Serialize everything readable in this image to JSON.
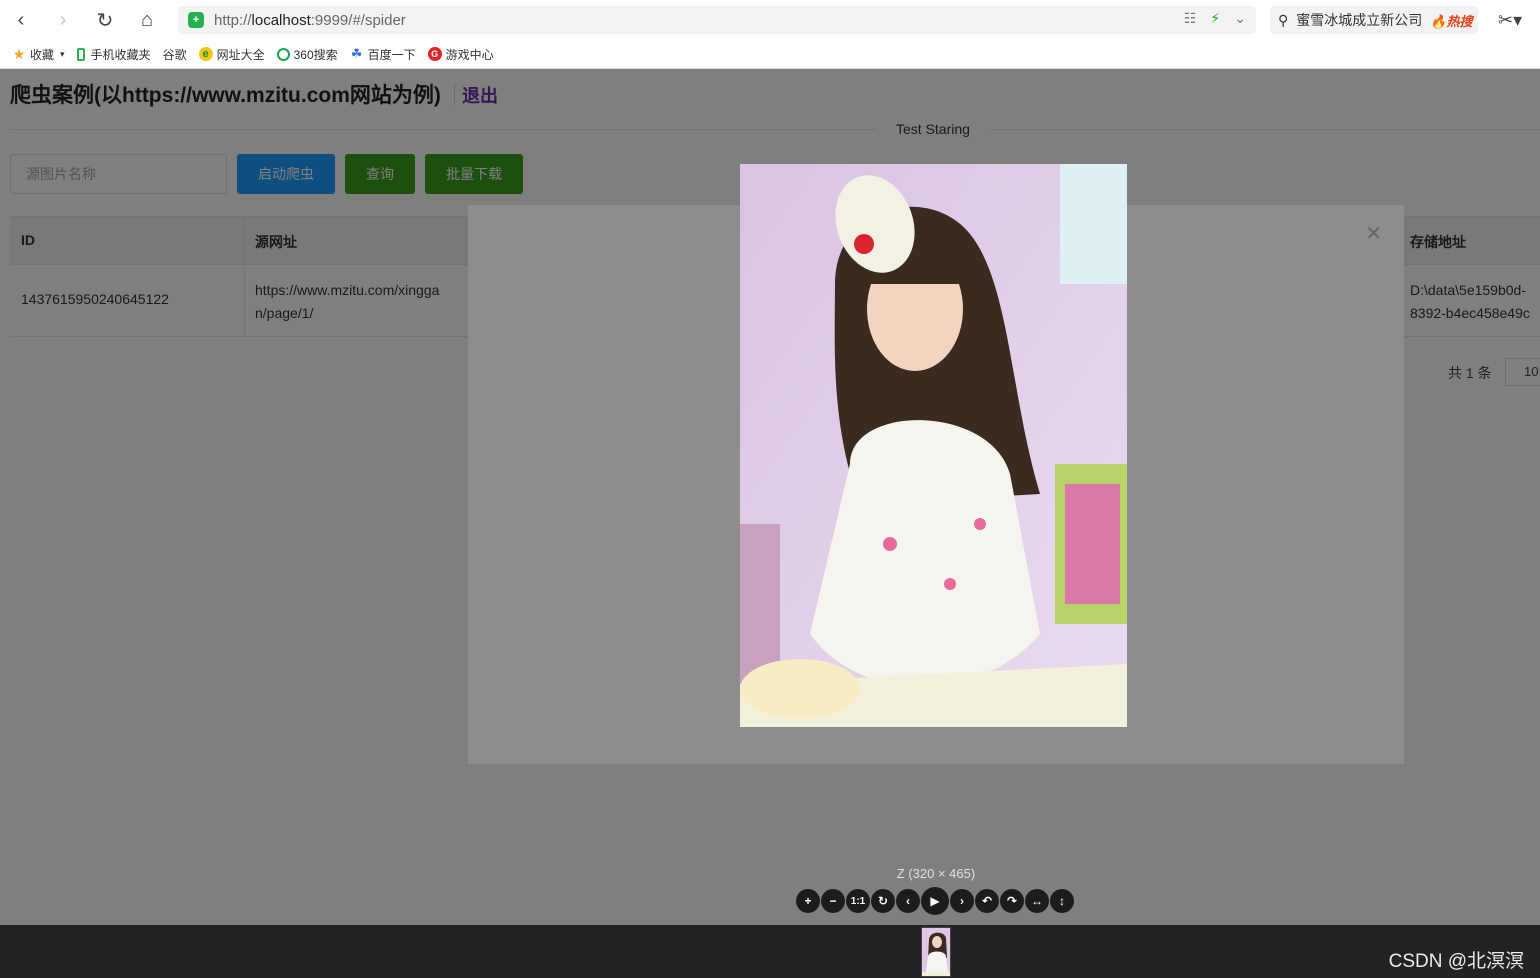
{
  "browser": {
    "url_scheme": "http://",
    "url_host": "localhost",
    "url_rest": ":9999/#/spider",
    "search_text": "蜜雪冰城成立新公司",
    "search_hot": "热搜",
    "bookmarks": [
      {
        "label": "收藏",
        "icon": "star-icon"
      },
      {
        "label": "手机收藏夹",
        "icon": "phone-icon"
      },
      {
        "label": "谷歌",
        "icon": "page-icon"
      },
      {
        "label": "网址大全",
        "icon": "browser-logo-icon"
      },
      {
        "label": "360搜索",
        "icon": "search-360-icon"
      },
      {
        "label": "百度一下",
        "icon": "baidu-paw-icon"
      },
      {
        "label": "游戏中心",
        "icon": "game-center-icon"
      }
    ]
  },
  "page": {
    "title": "爬虫案例(以https://www.mzitu.com网站为例)",
    "logout": "退出",
    "divider_text": "Test Staring",
    "search_placeholder": "源图片名称",
    "buttons": {
      "start": "启动爬虫",
      "query": "查询",
      "download": "批量下载"
    },
    "table": {
      "headers": {
        "id": "ID",
        "source": "源网址",
        "storage": "存储地址"
      },
      "rows": [
        {
          "id": "1437615950240645122",
          "source_line1": "https://www.mzitu.com/xingga",
          "source_line2": "n/page/1/",
          "storage_line1": "D:\\data\\5e159b0d-",
          "storage_line2": "8392-b4ec458e49c"
        }
      ]
    },
    "pager": {
      "total": "共 1 条",
      "size": "10"
    }
  },
  "viewer": {
    "caption": "Z (320 × 465)",
    "toolbar": [
      {
        "name": "zoom-in-icon",
        "glyph": "+"
      },
      {
        "name": "zoom-out-icon",
        "glyph": "−"
      },
      {
        "name": "one-to-one-icon",
        "glyph": "1:1"
      },
      {
        "name": "reset-icon",
        "glyph": "↻"
      },
      {
        "name": "prev-icon",
        "glyph": "‹"
      },
      {
        "name": "play-icon",
        "glyph": "▶"
      },
      {
        "name": "next-icon",
        "glyph": "›"
      },
      {
        "name": "rotate-left-icon",
        "glyph": "↶"
      },
      {
        "name": "rotate-right-icon",
        "glyph": "↷"
      },
      {
        "name": "flip-horizontal-icon",
        "glyph": "↔"
      },
      {
        "name": "flip-vertical-icon",
        "glyph": "↕"
      }
    ]
  },
  "watermark": "CSDN @北溟溟",
  "colors": {
    "primary_blue": "#1e9fff",
    "green": "#3a9e1e",
    "logout_purple": "#6a2ca8"
  }
}
